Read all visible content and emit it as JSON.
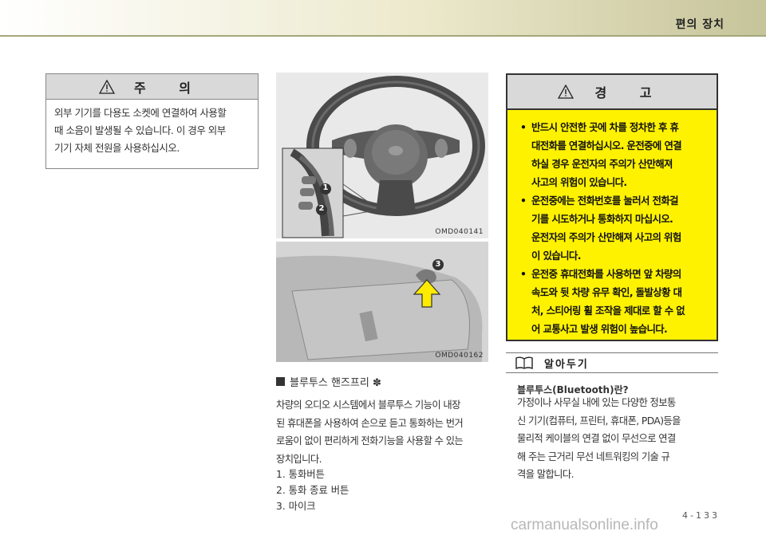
{
  "header": {
    "title": "편의 장치"
  },
  "caution": {
    "title": "주 의",
    "lines": [
      "외부 기기를 다용도 소켓에 연결하여 사용할",
      "때 소음이 발생될 수 있습니다. 이 경우 외부",
      "기기 자체 전원을 사용하십시오."
    ]
  },
  "images": [
    {
      "code": "OMD040141",
      "callouts": [
        "1",
        "2"
      ]
    },
    {
      "code": "OMD040162",
      "callouts": [
        "3"
      ]
    }
  ],
  "bluetooth": {
    "heading": "블루투스 핸즈프리 ✽",
    "para": [
      "차량의 오디오 시스템에서 블루투스 기능이 내장",
      "된 휴대폰을 사용하여 손으로 듣고 통화하는 번거",
      "로움이 없이 편리하게 전화기능을 사용할 수 있는",
      "장치입니다."
    ],
    "list": [
      "1. 통화버튼",
      "2. 통화 종료 버튼",
      "3. 마이크"
    ]
  },
  "warning": {
    "title": "경 고",
    "items": [
      [
        "반드시 안전한 곳에 차를 정차한 후 휴",
        "대전화를 연결하십시오. 운전중에 연결",
        "하실 경우 운전자의 주의가 산만해져",
        "사고의 위험이 있습니다."
      ],
      [
        "운전중에는 전화번호를 눌러서 전화걸",
        "기를 시도하거나 통화하지 마십시오.",
        "운전자의 주의가 산만해져 사고의 위험",
        "이 있습니다."
      ],
      [
        "운전중 휴대전화를 사용하면 앞 차량의",
        "속도와 뒷 차량 유무 확인, 돌발상황 대",
        "처, 스티어링 휠 조작을 제대로 할 수 없",
        "어 교통사고 발생 위험이 높습니다."
      ]
    ]
  },
  "note": {
    "title": "알아두기",
    "subtitle": "블루투스(Bluetooth)란?",
    "lines": [
      "가정이나 사무실 내에 있는 다양한 정보통",
      "신 기기(컴퓨터, 프린터, 휴대폰, PDA)등을",
      "물리적 케이블의 연결 없이 무선으로 연결",
      "해 주는 근거리 무선 네트워킹의 기술 규",
      "격을 말합니다."
    ]
  },
  "page_number": "4-133",
  "watermark": "carmanualsonline.info"
}
